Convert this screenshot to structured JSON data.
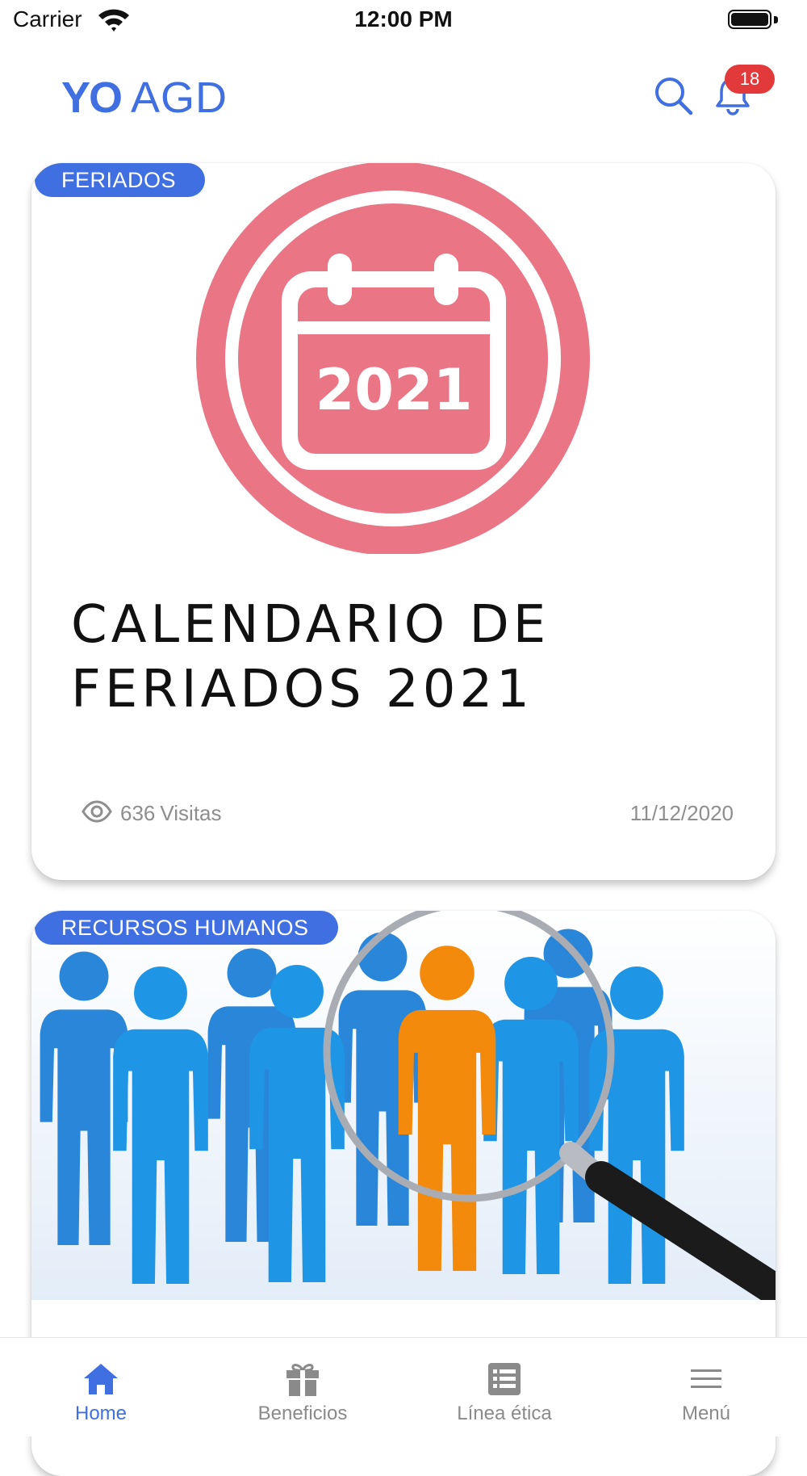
{
  "status_bar": {
    "carrier": "Carrier",
    "time": "12:00 PM"
  },
  "header": {
    "logo_bold": "YO",
    "logo_light": "AGD",
    "search_icon": "search-icon",
    "bell_icon": "bell-icon",
    "notification_count": "18"
  },
  "colors": {
    "accent": "#3f6fe0",
    "badge": "#e23a3a",
    "calendar_pink": "#e97585"
  },
  "cards": [
    {
      "category": "FERIADOS",
      "image_text": "2021",
      "title": "CALENDARIO DE FERIADOS 2021",
      "visits_count": "636",
      "visits_label": "Visitas",
      "date": "11/12/2020"
    },
    {
      "category": "RECURSOS HUMANOS"
    }
  ],
  "tabs": [
    {
      "label": "Home",
      "icon": "home-icon",
      "active": true
    },
    {
      "label": "Beneficios",
      "icon": "gift-icon",
      "active": false
    },
    {
      "label": "Línea ética",
      "icon": "list-icon",
      "active": false
    },
    {
      "label": "Menú",
      "icon": "menu-icon",
      "active": false
    }
  ]
}
